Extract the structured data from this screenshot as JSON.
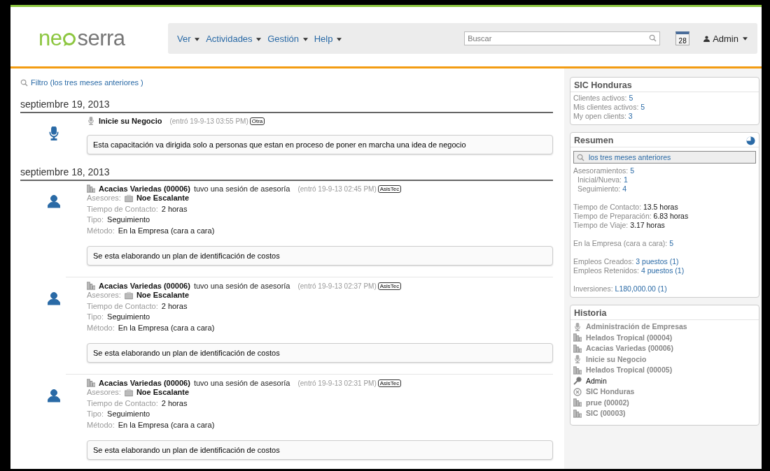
{
  "header": {
    "logo": {
      "before": "ne",
      "after": "serra"
    },
    "menu": [
      {
        "label": "Ver"
      },
      {
        "label": "Actividades"
      },
      {
        "label": "Gestión"
      },
      {
        "label": "Help"
      }
    ],
    "search": {
      "placeholder": "Buscar"
    },
    "calendar_day": "28",
    "user": "Admin"
  },
  "filter": "Filtro (los tres meses anteriores )",
  "days": [
    {
      "date": "septiembre 19, 2013",
      "entries": [
        {
          "kind": "activity",
          "title": "Inicie su Negocio",
          "entered": "(entró 19-9-13 03:55 PM)",
          "tag": "Otra",
          "note": "Esta capacitación va dirigida solo a personas que estan en proceso de poner en marcha una idea de negocio"
        }
      ]
    },
    {
      "date": "septiembre 18, 2013",
      "entries": [
        {
          "kind": "session",
          "title": "Acacias Variedas (00006)",
          "title_rest": "tuvo una sesión de asesoría",
          "entered": "(entró 19-9-13 02:45 PM)",
          "tag": "AsisTec",
          "advisor_label": "Asesores:",
          "advisor": "Noe Escalante",
          "fields": [
            {
              "label": "Tiempo de Contacto:",
              "value": "2 horas"
            },
            {
              "label": "Tipo:",
              "value": "Seguimiento"
            },
            {
              "label": "Método:",
              "value": "En la Empresa (cara a cara)"
            }
          ],
          "note": "Se esta elaborando un plan de identificación de costos"
        },
        {
          "kind": "session",
          "title": "Acacias Variedas (00006)",
          "title_rest": "tuvo una sesión de asesoría",
          "entered": "(entró 19-9-13 02:37 PM)",
          "tag": "AsisTec",
          "advisor_label": "Asesores:",
          "advisor": "Noe Escalante",
          "fields": [
            {
              "label": "Tiempo de Contacto:",
              "value": "2 horas"
            },
            {
              "label": "Tipo:",
              "value": "Seguimiento"
            },
            {
              "label": "Método:",
              "value": "En la Empresa (cara a cara)"
            }
          ],
          "note": "Se esta elaborando un plan de identificación de costos"
        },
        {
          "kind": "session",
          "title": "Acacias Variedas (00006)",
          "title_rest": "tuvo una sesión de asesoría",
          "entered": "(entró 19-9-13 02:31 PM)",
          "tag": "AsisTec",
          "advisor_label": "Asesores:",
          "advisor": "Noe Escalante",
          "fields": [
            {
              "label": "Tiempo de Contacto:",
              "value": "2 horas"
            },
            {
              "label": "Tipo:",
              "value": "Seguimiento"
            },
            {
              "label": "Método:",
              "value": "En la Empresa (cara a cara)"
            }
          ],
          "note": "Se esta elaborando un plan de identificación de costos"
        }
      ]
    }
  ],
  "center": {
    "title": "SIC Honduras",
    "stats": [
      {
        "label": "Clientes activos:",
        "value": "5"
      },
      {
        "label": "Mis clientes activos:",
        "value": "5"
      },
      {
        "label": "My open clients:",
        "value": "3"
      }
    ]
  },
  "summary": {
    "title": "Resumen",
    "filter": "los tres meses anteriores",
    "groups": [
      [
        {
          "label": "Asesoramientos:",
          "value": "5",
          "kind": "link",
          "children": [
            {
              "label": "Inicial/Nueva:",
              "value": "1",
              "kind": "link"
            },
            {
              "label": "Seguimiento:",
              "value": "4",
              "kind": "link"
            }
          ]
        }
      ],
      [
        {
          "label": "Tiempo de Contacto:",
          "value": "13.5 horas",
          "kind": "plain"
        },
        {
          "label": "Tiempo de Preparación:",
          "value": "6.83 horas",
          "kind": "plain"
        },
        {
          "label": "Tiempo de Viaje:",
          "value": "3.17 horas",
          "kind": "plain"
        }
      ],
      [
        {
          "label": "En la Empresa (cara a cara):",
          "value": "5",
          "kind": "link"
        }
      ],
      [
        {
          "label": "Empleos Creados:",
          "value": "3 puestos (1)",
          "kind": "link"
        },
        {
          "label": "Empleos Retenidos:",
          "value": "4 puestos (1)",
          "kind": "link"
        }
      ],
      [
        {
          "label": "Inversiones:",
          "value": "L180,000.00 (1)",
          "kind": "link"
        }
      ]
    ]
  },
  "history": {
    "title": "Historia",
    "items": [
      {
        "kind": "event",
        "label": "Administración de Empresas"
      },
      {
        "kind": "client",
        "label": "Helados Tropical (00004)"
      },
      {
        "kind": "client",
        "label": "Acacias Variedas (00006)"
      },
      {
        "kind": "event",
        "label": "Inicie su Negocio"
      },
      {
        "kind": "client",
        "label": "Helados Tropical (00005)"
      },
      {
        "kind": "user",
        "label": "Admin"
      },
      {
        "kind": "center",
        "label": "SIC Honduras"
      },
      {
        "kind": "client",
        "label": "prue (00002)"
      },
      {
        "kind": "client",
        "label": "SIC (00003)"
      }
    ]
  }
}
